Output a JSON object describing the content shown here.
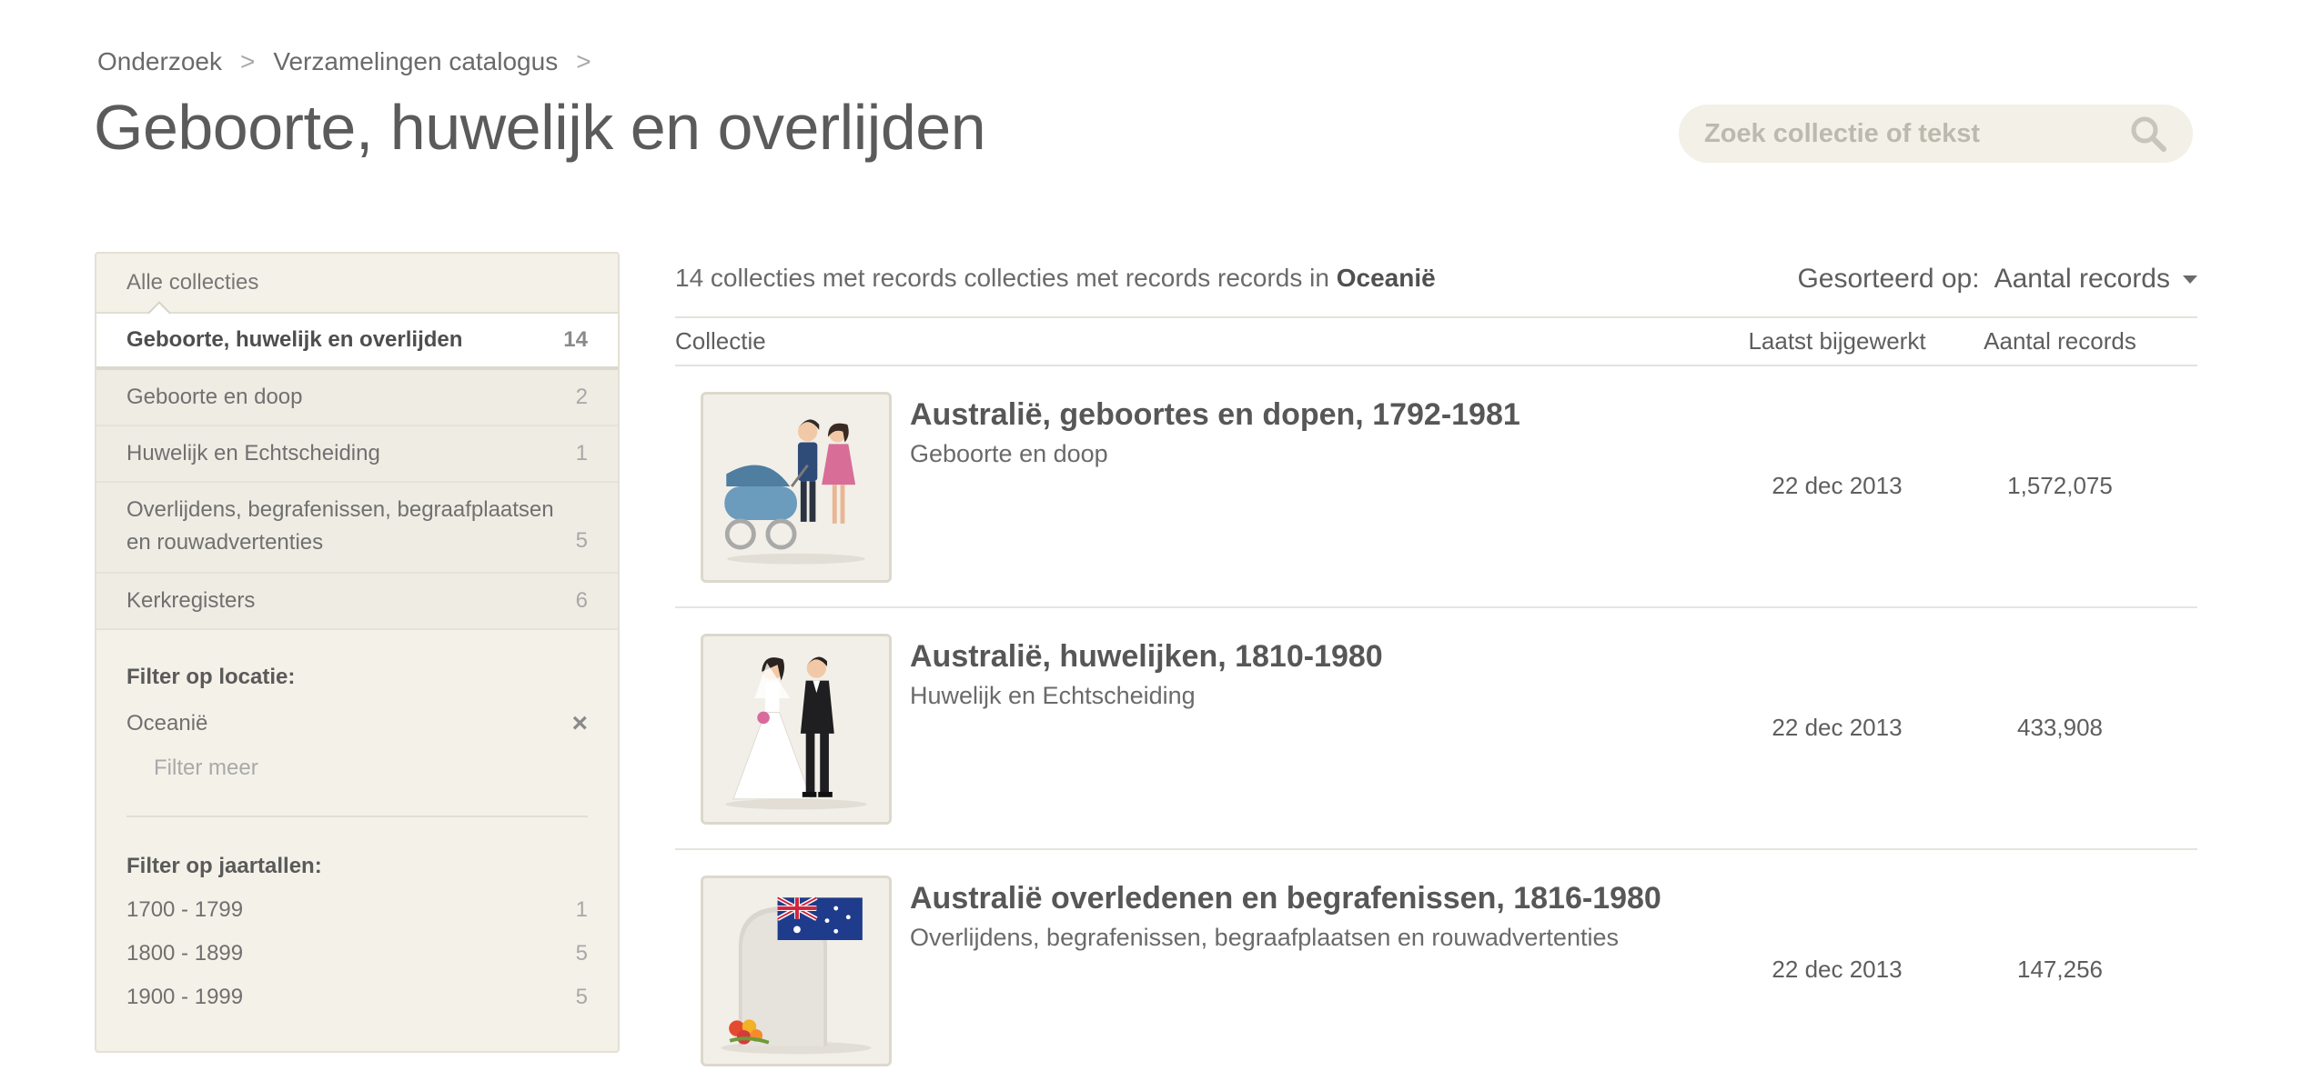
{
  "breadcrumb": {
    "items": [
      "Onderzoek",
      "Verzamelingen catalogus"
    ],
    "separator": ">"
  },
  "page": {
    "title": "Geboorte, huwelijk en overlijden"
  },
  "search": {
    "placeholder": "Zoek collectie of tekst",
    "icon": "search-icon"
  },
  "sidebar": {
    "all_label": "Alle collecties",
    "active": {
      "label": "Geboorte, huwelijk en overlijden",
      "count": "14"
    },
    "items": [
      {
        "label": "Geboorte en doop",
        "count": "2"
      },
      {
        "label": "Huwelijk en Echtscheiding",
        "count": "1"
      },
      {
        "label_line1": "Overlijdens, begrafenissen, begraafplaatsen",
        "label_line2": "en rouwadvertenties",
        "count": "5"
      },
      {
        "label": "Kerkregisters",
        "count": "6"
      }
    ],
    "location_filter": {
      "heading": "Filter op locatie:",
      "selected": "Oceanië",
      "more": "Filter meer"
    },
    "year_filter": {
      "heading": "Filter op jaartallen:",
      "ranges": [
        {
          "label": "1700 - 1799",
          "count": "1"
        },
        {
          "label": "1800 - 1899",
          "count": "5"
        },
        {
          "label": "1900 - 1999",
          "count": "5"
        }
      ]
    }
  },
  "results": {
    "summary_text": "14 collecties met records collecties met records records in ",
    "summary_location": "Oceanië",
    "sort_label": "Gesorteerd op:",
    "sort_value": "Aantal records"
  },
  "table": {
    "headers": {
      "collection": "Collectie",
      "updated": "Laatst bijgewerkt",
      "records": "Aantal records"
    },
    "rows": [
      {
        "title": "Australië, geboortes en dopen, 1792-1981",
        "category": "Geboorte en doop",
        "updated": "22 dec 2013",
        "records": "1,572,075",
        "thumbnail": "parents-with-pram"
      },
      {
        "title": "Australië, huwelijken, 1810-1980",
        "category": "Huwelijk en Echtscheiding",
        "updated": "22 dec 2013",
        "records": "433,908",
        "thumbnail": "wedding-couple"
      },
      {
        "title": "Australië overledenen en begrafenissen, 1816-1980",
        "category": "Overlijdens, begrafenissen, begraafplaatsen en rouwadvertenties",
        "updated": "22 dec 2013",
        "records": "147,256",
        "thumbnail": "gravestone-with-australian-flag"
      }
    ]
  }
}
